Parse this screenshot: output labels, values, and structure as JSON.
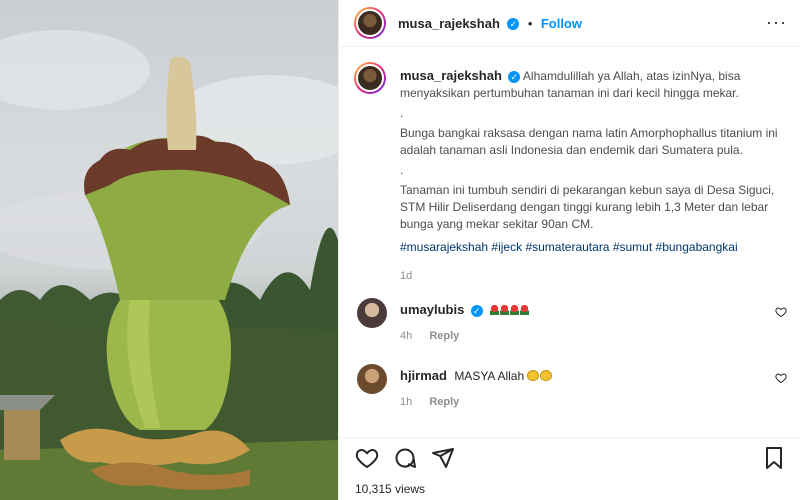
{
  "post": {
    "username": "musa_rajekshah",
    "follow_label": "Follow",
    "dot": "•",
    "verified_glyph": "✓",
    "more_glyph": "···"
  },
  "caption": {
    "username": "musa_rajekshah",
    "line1": "Alhamdulillah ya Allah, atas izinNya, bisa menyaksikan pertumbuhan tanaman ini dari kecil hingga mekar.",
    "sep1": ".",
    "para2": "Bunga bangkai raksasa dengan nama latin Amorphophallus titanium ini adalah tanaman asli Indonesia dan endemik dari Sumatera pula.",
    "sep2": ".",
    "para3": "Tanaman ini tumbuh sendiri di pekarangan kebun saya di Desa Siguci, STM Hilir Deliserdang dengan tinggi kurang lebih 1,3 Meter dan lebar bunga yang mekar sekitar 90an CM.",
    "hashtags": [
      "#musarajekshah",
      "#ijeck",
      "#sumaterautara",
      "#sumut",
      "#bungabangkai"
    ],
    "age": "1d"
  },
  "comments": [
    {
      "username": "umaylubis",
      "text": "",
      "emoji": "flower-x4",
      "age": "4h",
      "reply_label": "Reply"
    },
    {
      "username": "hjirmad",
      "text": "MASYA Allah",
      "emoji": "clap-x2",
      "age": "1h",
      "reply_label": "Reply"
    }
  ],
  "stats": {
    "views": "10,315 views"
  },
  "icons": {
    "like": "heart-icon",
    "comment": "comment-icon",
    "share": "share-icon",
    "save": "bookmark-icon"
  },
  "colors": {
    "accent": "#0095f6",
    "hashtag": "#00376b",
    "muted": "#8e8e8e"
  }
}
